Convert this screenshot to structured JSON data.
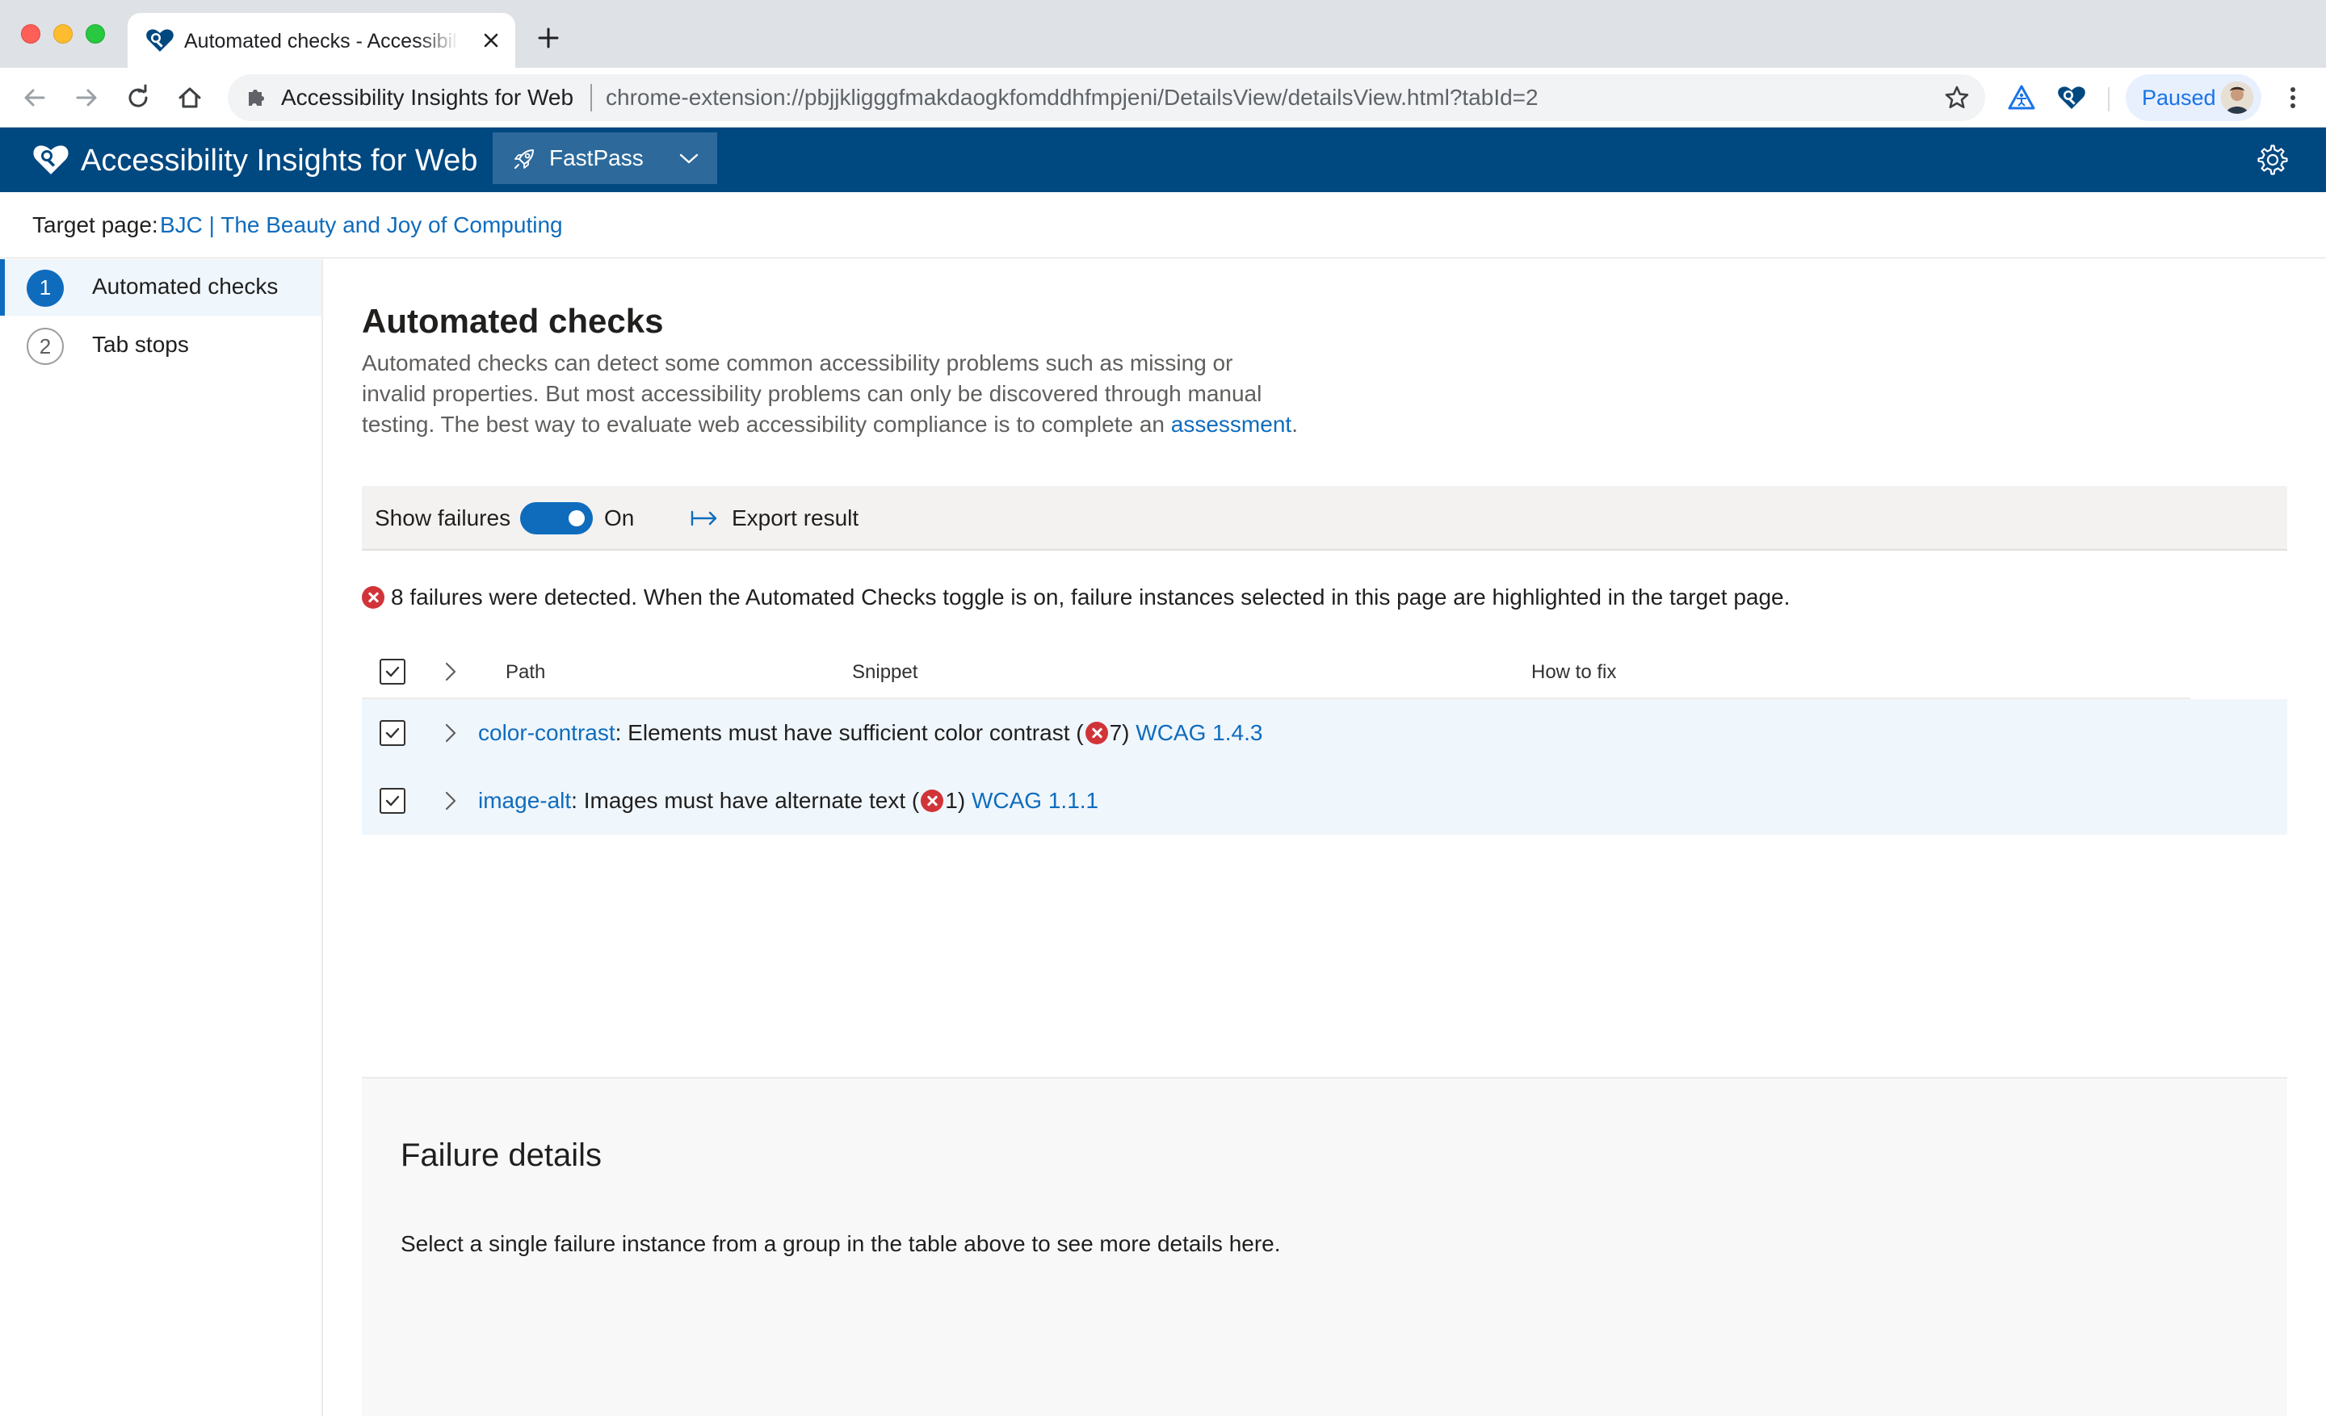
{
  "browser": {
    "tab_title": "Automated checks - Accessibility Insights for Web",
    "omnibox_site": "Accessibility Insights for Web",
    "omnibox_url": "chrome-extension://pbjjkligggfmakdaogkfomddhfmpjeni/DetailsView/detailsView.html?tabId=2",
    "profile_label": "Paused"
  },
  "header": {
    "title": "Accessibility Insights for Web",
    "mode": "FastPass",
    "brand_color": "#004880"
  },
  "target": {
    "label": "Target page:",
    "link": "BJC | The Beauty and Joy of Computing"
  },
  "nav": {
    "items": [
      {
        "number": "1",
        "label": "Automated checks",
        "selected": true
      },
      {
        "number": "2",
        "label": "Tab stops",
        "selected": false
      }
    ]
  },
  "main": {
    "title": "Automated checks",
    "desc_line1": "Automated checks can detect some common accessibility problems such as missing or",
    "desc_line2": "invalid properties. But most accessibility problems can only be discovered through manual",
    "desc_line3": "testing. The best way to evaluate web accessibility compliance is to complete an ",
    "desc_link": "assessment",
    "desc_end": "."
  },
  "commandbar": {
    "show_failures_label": "Show failures",
    "toggle_state": "On",
    "export_label": "Export result"
  },
  "summary": {
    "text": "8 failures were detected. When the Automated Checks toggle is on, failure instances selected in this page are highlighted in the target page."
  },
  "table": {
    "columns": [
      "Path",
      "Snippet",
      "How to fix"
    ],
    "groups": [
      {
        "rule_id": "color-contrast",
        "description": ": Elements must have sufficient color contrast (",
        "count": "7",
        "close": ") ",
        "wcag": "WCAG 1.4.3"
      },
      {
        "rule_id": "image-alt",
        "description": ": Images must have alternate text (",
        "count": "1",
        "close": ") ",
        "wcag": "WCAG 1.1.1"
      }
    ]
  },
  "details": {
    "title": "Failure details",
    "text": "Select a single failure instance from a group in the table above to see more details here."
  }
}
